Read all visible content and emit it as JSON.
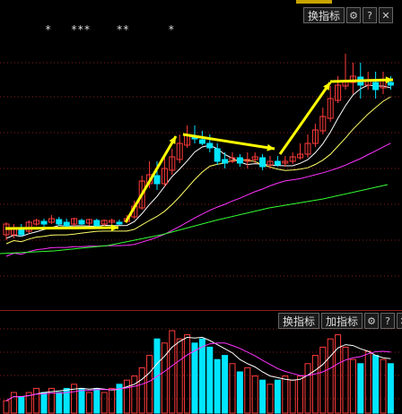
{
  "colors": {
    "background": "#000000",
    "up_candle": "#ff3b3b",
    "down_candle": "#00e5ff",
    "ma_white": "#ffffff",
    "ma_yellow": "#ffff66",
    "ma_magenta": "#ff33ff",
    "ma_green": "#33ff33",
    "arrow": "#ffff00",
    "grid": "#8a1c1c"
  },
  "main_toolbar": {
    "switch_indicator": "换指标",
    "gear_icon": "⚙",
    "help_icon": "?",
    "close_icon": "✕"
  },
  "vol_toolbar": {
    "switch_indicator": "换指标",
    "add_indicator": "加指标",
    "gear_icon": "⚙",
    "help_icon": "?",
    "close_icon": "✕"
  },
  "markers": "*   ***    **      *",
  "chart_data": {
    "type": "candlestick",
    "candles": [
      [
        250,
        262,
        248,
        268,
        1
      ],
      [
        262,
        255,
        250,
        266,
        1
      ],
      [
        255,
        262,
        250,
        264,
        -1
      ],
      [
        258,
        248,
        246,
        260,
        1
      ],
      [
        250,
        246,
        244,
        252,
        1
      ],
      [
        247,
        250,
        244,
        253,
        -1
      ],
      [
        248,
        244,
        240,
        250,
        1
      ],
      [
        245,
        250,
        242,
        252,
        -1
      ],
      [
        248,
        252,
        244,
        254,
        -1
      ],
      [
        250,
        244,
        243,
        253,
        1
      ],
      [
        246,
        250,
        244,
        251,
        -1
      ],
      [
        249,
        245,
        244,
        252,
        1
      ],
      [
        246,
        252,
        244,
        253,
        -1
      ],
      [
        250,
        246,
        245,
        252,
        1
      ],
      [
        248,
        246,
        244,
        250,
        1
      ],
      [
        248,
        250,
        245,
        251,
        -1
      ],
      [
        247,
        244,
        240,
        249,
        1
      ],
      [
        242,
        230,
        224,
        244,
        1
      ],
      [
        232,
        202,
        196,
        234,
        1
      ],
      [
        205,
        195,
        180,
        210,
        1
      ],
      [
        196,
        205,
        180,
        212,
        -1
      ],
      [
        205,
        188,
        175,
        208,
        1
      ],
      [
        190,
        175,
        166,
        195,
        1
      ],
      [
        178,
        160,
        150,
        182,
        1
      ],
      [
        162,
        150,
        140,
        165,
        1
      ],
      [
        152,
        155,
        140,
        160,
        -1
      ],
      [
        156,
        160,
        146,
        162,
        -1
      ],
      [
        160,
        165,
        150,
        170,
        -1
      ],
      [
        166,
        180,
        160,
        184,
        -1
      ],
      [
        178,
        182,
        170,
        188,
        -1
      ],
      [
        180,
        176,
        170,
        182,
        1
      ],
      [
        176,
        182,
        172,
        186,
        -1
      ],
      [
        180,
        178,
        170,
        188,
        1
      ],
      [
        178,
        175,
        170,
        182,
        1
      ],
      [
        176,
        186,
        172,
        190,
        -1
      ],
      [
        184,
        180,
        174,
        188,
        1
      ],
      [
        180,
        184,
        174,
        186,
        -1
      ],
      [
        182,
        180,
        174,
        186,
        1
      ],
      [
        180,
        175,
        170,
        183,
        1
      ],
      [
        176,
        172,
        160,
        178,
        1
      ],
      [
        172,
        160,
        150,
        176,
        1
      ],
      [
        160,
        145,
        138,
        164,
        1
      ],
      [
        146,
        130,
        120,
        150,
        1
      ],
      [
        132,
        110,
        96,
        136,
        1
      ],
      [
        112,
        95,
        85,
        115,
        1
      ],
      [
        96,
        90,
        60,
        100,
        1
      ],
      [
        92,
        85,
        70,
        105,
        1
      ],
      [
        86,
        95,
        70,
        110,
        -1
      ],
      [
        95,
        90,
        80,
        100,
        1
      ],
      [
        92,
        100,
        80,
        110,
        -1
      ],
      [
        98,
        90,
        80,
        105,
        1
      ],
      [
        92,
        95,
        85,
        100,
        -1
      ]
    ],
    "volumes": [
      3,
      5,
      4,
      5,
      6,
      5,
      6,
      5,
      6,
      7,
      6,
      5,
      6,
      5,
      6,
      7,
      8,
      9,
      11,
      14,
      18,
      17,
      20,
      18,
      19,
      17,
      18,
      16,
      13,
      14,
      12,
      10,
      11,
      9,
      8,
      7,
      8,
      9,
      8,
      9,
      12,
      14,
      16,
      18,
      19,
      16,
      13,
      12,
      15,
      14,
      13,
      12
    ]
  }
}
